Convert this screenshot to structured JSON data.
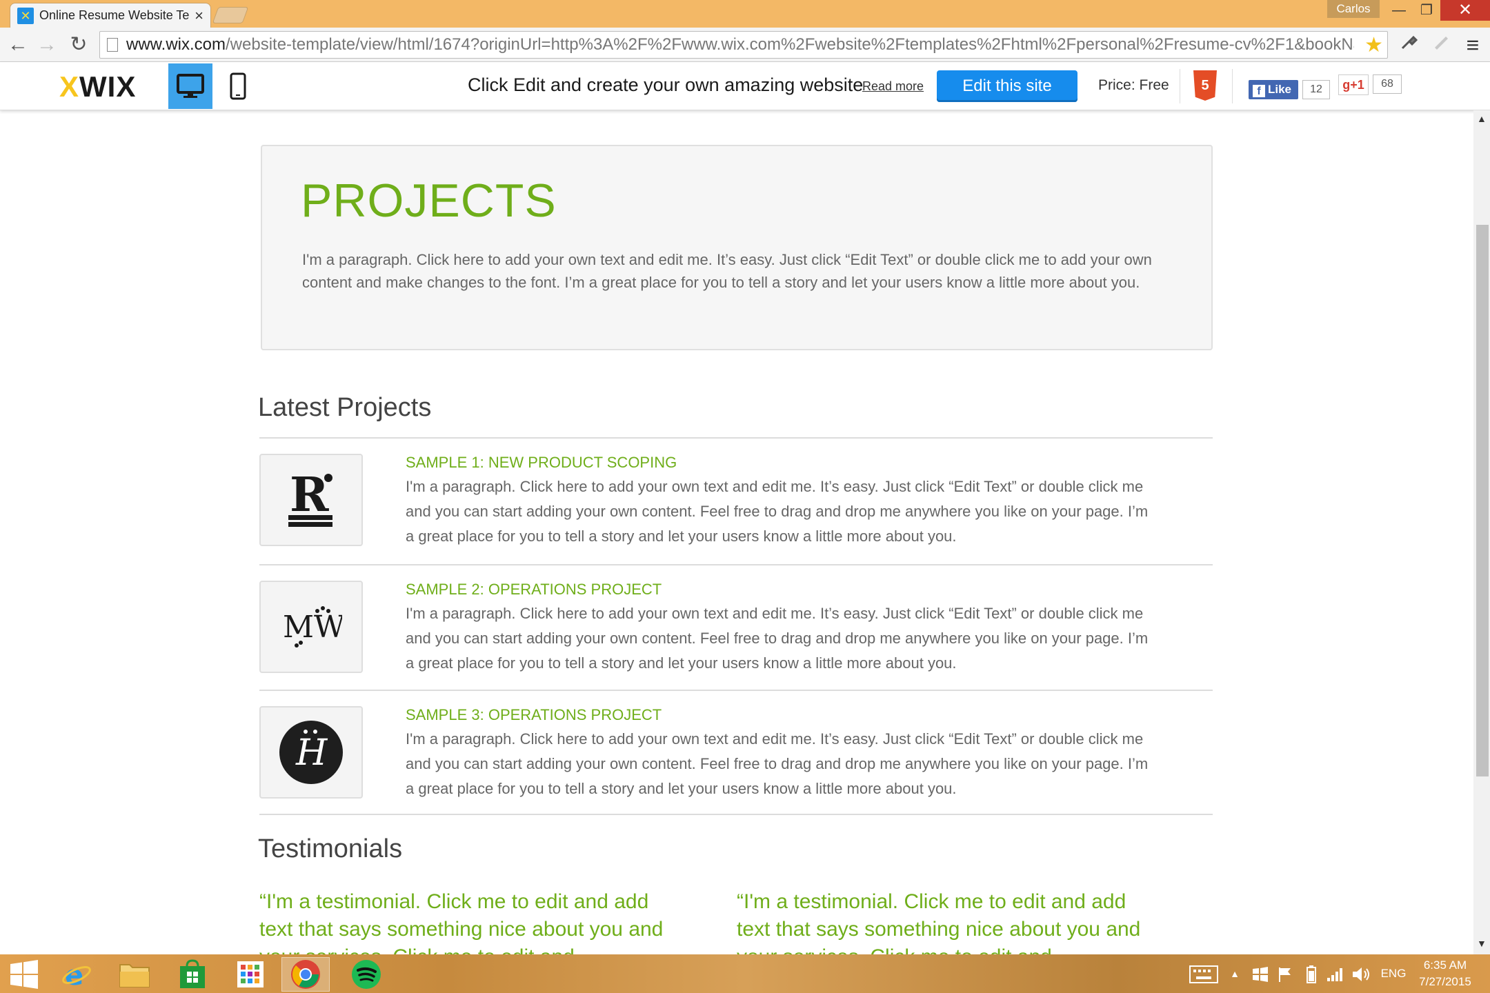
{
  "browser": {
    "tab_title": "Online Resume Website Te",
    "tab_close": "×",
    "user": "Carlos",
    "window_min": "—",
    "window_max": "❐",
    "window_close": "✕",
    "url_host": "www.wix.com",
    "url_rest": "/website-template/view/html/1674?originUrl=http%3A%2F%2Fwww.wix.com%2Fwebsite%2Ftemplates%2Fhtml%2Fpersonal%2Fresume-cv%2F1&bookNam",
    "nav_back": "←",
    "nav_forward": "→",
    "nav_reload": "↻",
    "star": "★",
    "menu": "≡"
  },
  "wix": {
    "logo_x": "X",
    "logo_text": "WIX",
    "promo": "Click Edit and create your own amazing website",
    "read_more": "Read more",
    "edit_button": "Edit this site",
    "price": "Price: Free",
    "html5_badge": "5",
    "fb_like": "Like",
    "fb_count": "12",
    "gplus": "g+1",
    "gplus_count": "68"
  },
  "page": {
    "projects_title": "PROJECTS",
    "projects_paragraph": "I'm a paragraph. Click here to add your own text and edit me. It’s easy. Just click “Edit Text” or double click me to add your own content and make changes to the font. I’m a great place for you to tell a story and let your users know a little more about you.",
    "latest_title": "Latest Projects",
    "projects": [
      {
        "title": "SAMPLE 1: NEW PRODUCT SCOPING",
        "description": "I'm a paragraph. Click here to add your own text and edit me. It’s easy. Just click “Edit Text” or double click me and you can start adding your own content. Feel free to drag and drop me anywhere you like on your page. I’m a great place for you to tell a story and let your users know a little more about you.",
        "logo": "R"
      },
      {
        "title": "SAMPLE 2: OPERATIONS PROJECT",
        "description": "I'm a paragraph. Click here to add your own text and edit me. It’s easy. Just click “Edit Text” or double click me and you can start adding your own content. Feel free to drag and drop me anywhere you like on your page. I’m a great place for you to tell a story and let your users know a little more about you.",
        "logo": "MW"
      },
      {
        "title": "SAMPLE 3: OPERATIONS PROJECT",
        "description": "I'm a paragraph. Click here to add your own text and edit me. It’s easy. Just click “Edit Text” or double click me and you can start adding your own content. Feel free to drag and drop me anywhere you like on your page. I’m a great place for you to tell a story and let your users know a little more about you.",
        "logo": "H"
      }
    ],
    "testimonials_title": "Testimonials",
    "testimonials": [
      "“I'm a testimonial. Click me to edit and add text that says something nice about you and your services. Click me to edit and",
      "“I'm a testimonial. Click me to edit and add text that says something nice about you and your services. Click me to edit and"
    ]
  },
  "taskbar": {
    "apps": [
      "start-icon",
      "internet-explorer-icon",
      "file-explorer-icon",
      "windows-store-icon",
      "apps-grid-icon",
      "chrome-icon",
      "spotify-icon"
    ],
    "language": "ENG",
    "time": "6:35 AM",
    "date": "7/27/2015"
  },
  "colors": {
    "accent_green": "#6fae1a",
    "wix_blue": "#168ced",
    "chrome_frame": "#f3b866",
    "taskbar": "#d29a50"
  }
}
